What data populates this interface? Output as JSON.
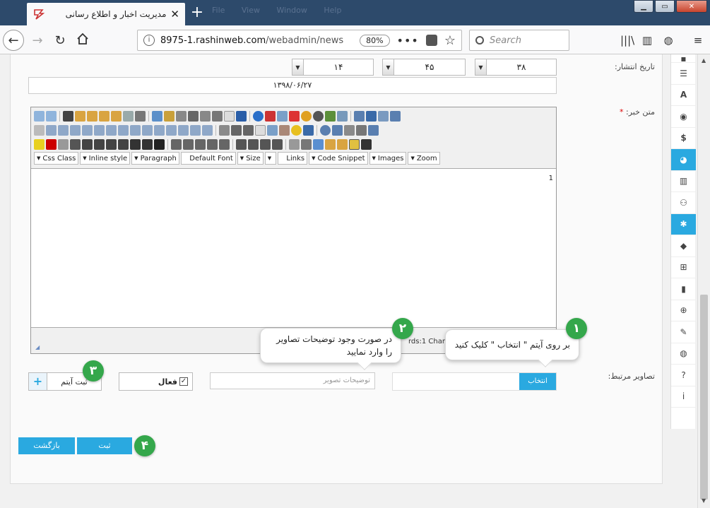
{
  "browser": {
    "tab_title": "مدیریت اخبار و اطلاع رسانی",
    "tab_close": "✕",
    "new_tab": "+",
    "faded_menu": "File View Window Help",
    "url_domain": "8975-1.rashinweb.com",
    "url_path": "/webadmin/news",
    "zoom": "80%",
    "search_placeholder": "Search"
  },
  "form": {
    "publish_date_label": "تاریخ انتشار:",
    "date_parts": [
      "۳۸",
      "۴۵",
      "۱۴"
    ],
    "date_value": "۱۳۹۸/۰۶/۲۷",
    "news_text_label": "متن خبر:",
    "required_mark": "*",
    "related_images_label": "تصاویر مرتبط:",
    "select_button": "انتخاب",
    "image_description_placeholder": "توضیحات تصویر",
    "active_label": "فعال",
    "add_item_label": "ثبت آیتم",
    "add_plus": "+",
    "submit_label": "ثبت",
    "back_label": "بازگشت"
  },
  "editor": {
    "dropdowns": [
      "Css Class",
      "Inline style",
      "Paragraph",
      "Default Font",
      "Size",
      "",
      "Links",
      "Code Snippet",
      "Images",
      "Zoom"
    ],
    "content": "1",
    "status_text": "rds:1 Characte"
  },
  "tooltips": {
    "tip1": "بر روی آیتم \" انتخاب \" کلیک کنید",
    "tip2": "در صورت وجود توضیحات تصاویر را وارد نمایید"
  },
  "markers": [
    "۱",
    "۲",
    "۳",
    "۴"
  ],
  "colors": {
    "accent": "#2aa9e0",
    "marker_green": "#34a74b",
    "titlebar": "#2d4a6b"
  },
  "sidebar_icons": [
    "menu-icon",
    "list-icon",
    "font-icon",
    "users-icon",
    "dollar-icon",
    "pie-chart-icon",
    "bar-chart-icon",
    "sitemap-icon",
    "gear-icon",
    "tags-icon",
    "windows-icon",
    "file-icon",
    "zoom-icon",
    "wrench-icon",
    "globe-icon",
    "help-icon",
    "info-icon"
  ]
}
